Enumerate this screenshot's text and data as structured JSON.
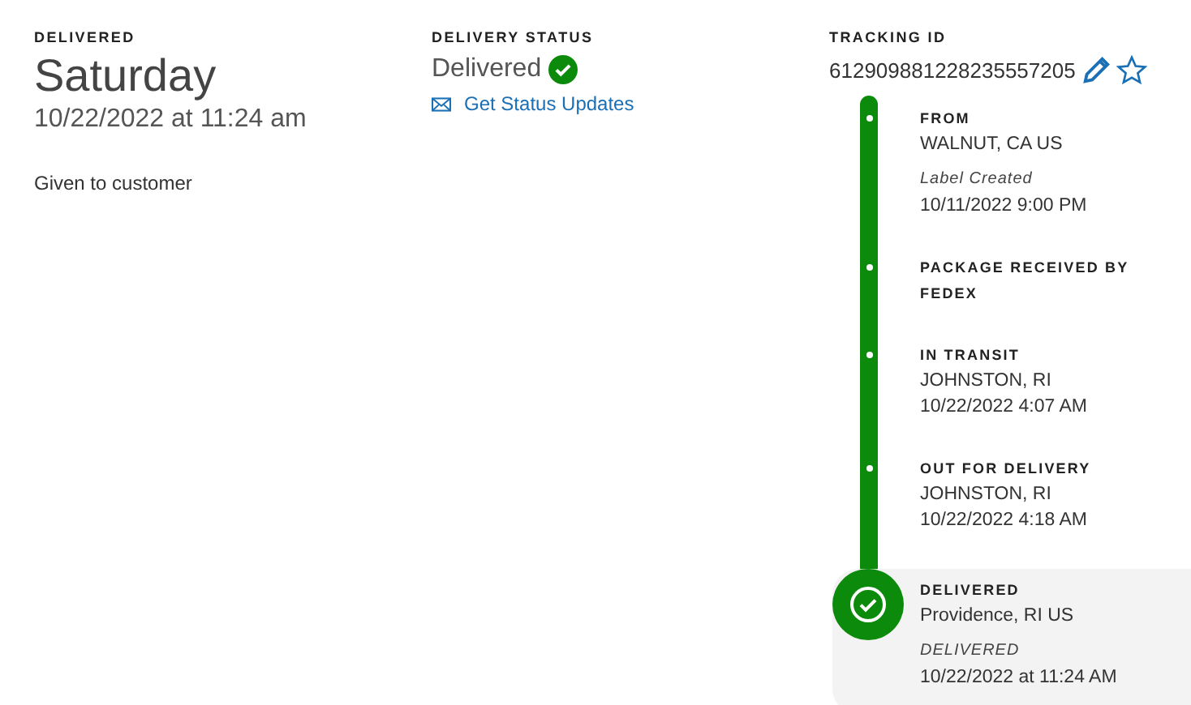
{
  "delivered": {
    "label": "DELIVERED",
    "day": "Saturday",
    "datetime": "10/22/2022 at 11:24 am",
    "note": "Given to customer"
  },
  "delivery_status": {
    "label": "DELIVERY STATUS",
    "status": "Delivered",
    "link": "Get Status Updates"
  },
  "tracking": {
    "label": "TRACKING ID",
    "id": "612909881228235557205"
  },
  "events": [
    {
      "kind": "dot",
      "title": "FROM",
      "location": "WALNUT, CA US",
      "note": "Label Created",
      "time": "10/11/2022 9:00 PM",
      "selected": false
    },
    {
      "kind": "dot",
      "title": "PACKAGE RECEIVED BY FEDEX",
      "selected": false
    },
    {
      "kind": "dot",
      "title": "IN TRANSIT",
      "location": "JOHNSTON, RI",
      "time": "10/22/2022 4:07 AM",
      "selected": false
    },
    {
      "kind": "dot",
      "title": "OUT FOR DELIVERY",
      "location": "JOHNSTON, RI",
      "time": "10/22/2022 4:18 AM",
      "selected": false
    },
    {
      "kind": "check",
      "title": "DELIVERED",
      "location": "Providence, RI US",
      "note": "DELIVERED",
      "time": "10/22/2022 at 11:24 AM",
      "selected": true
    }
  ]
}
